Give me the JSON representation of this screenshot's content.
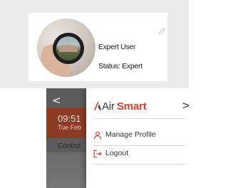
{
  "profile": {
    "name": "Expert User",
    "status": "Status: Expert",
    "edit_icon": "pencil-icon"
  },
  "background_app": {
    "back_icon": "<",
    "time": "09:51",
    "date": "Tue Feb",
    "section": "Control"
  },
  "drawer": {
    "brand_air": "Air",
    "brand_smart": "Smart",
    "close_icon": ">",
    "items": [
      {
        "label": "Manage Profile",
        "icon": "user-icon"
      },
      {
        "label": "Logout",
        "icon": "logout-icon"
      }
    ]
  },
  "colors": {
    "accent": "#d1432f",
    "panel_bg": "#ebebeb",
    "time_band": "#8d3b25"
  }
}
